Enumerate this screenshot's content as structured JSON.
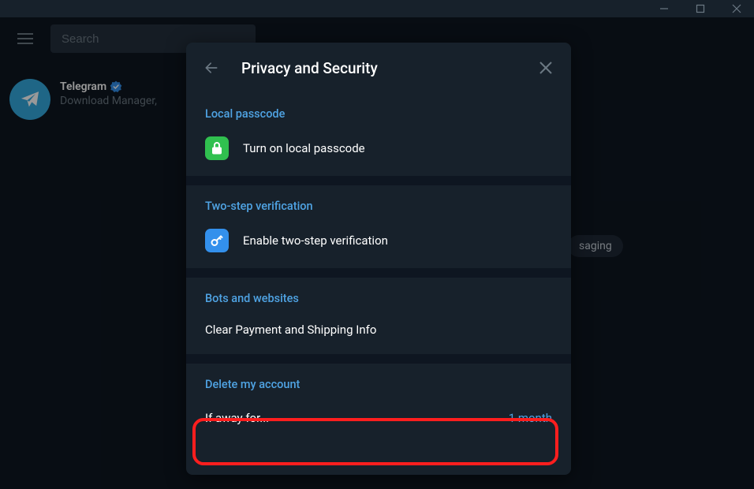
{
  "search": {
    "placeholder": "Search"
  },
  "chat": {
    "name": "Telegram",
    "preview": "Download Manager,"
  },
  "bg_pill": "saging",
  "dialog": {
    "title": "Privacy and Security",
    "sections": {
      "local_passcode": {
        "title": "Local passcode",
        "action": "Turn on local passcode"
      },
      "two_step": {
        "title": "Two-step verification",
        "action": "Enable two-step verification"
      },
      "bots": {
        "title": "Bots and websites",
        "action": "Clear Payment and Shipping Info"
      },
      "delete": {
        "title": "Delete my account",
        "label": "If away for...",
        "value": "1 month"
      }
    }
  }
}
